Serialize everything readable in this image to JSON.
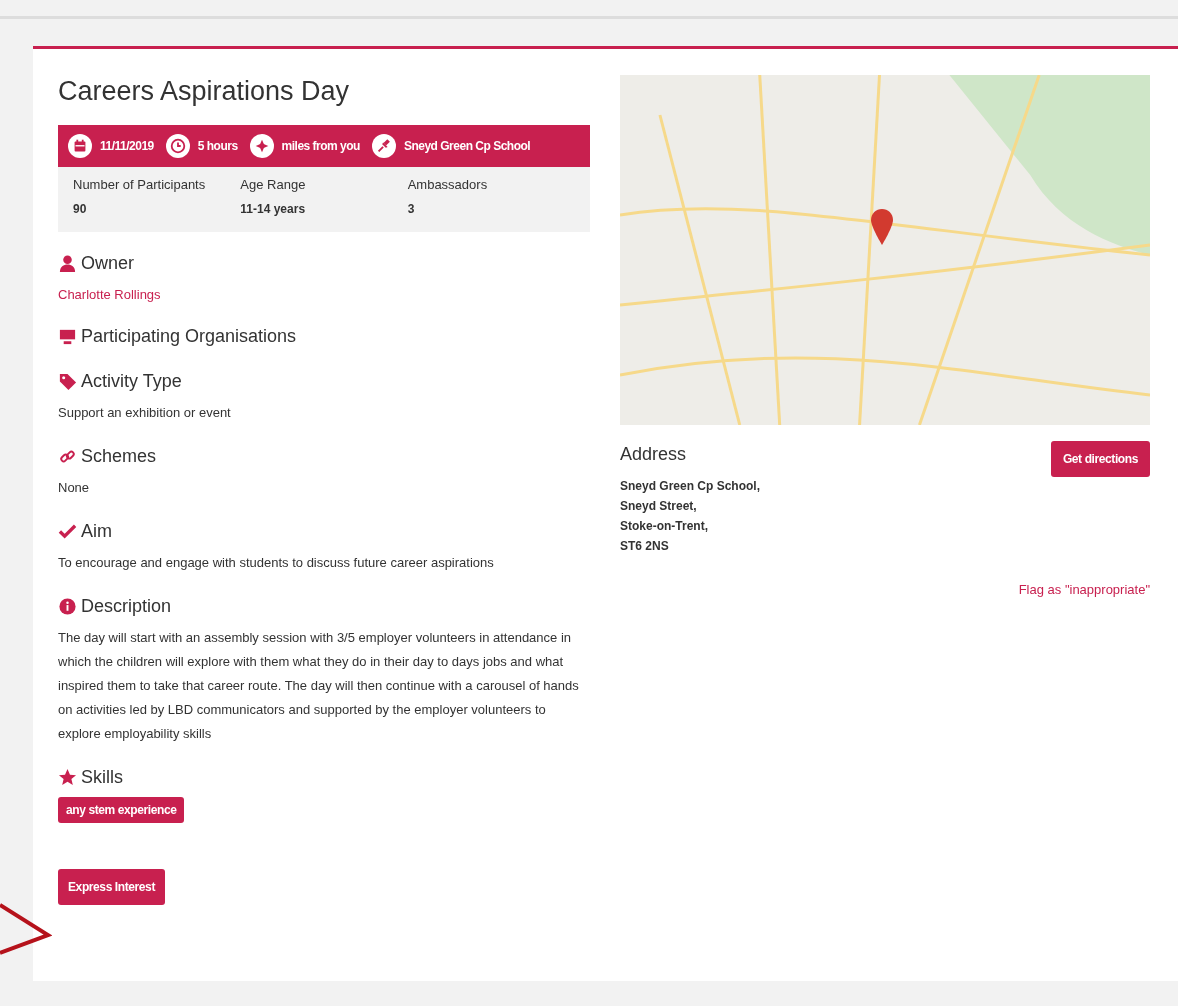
{
  "title": "Careers Aspirations Day",
  "banner": [
    {
      "kind": "date",
      "text": "11/11/2019"
    },
    {
      "kind": "duration",
      "text": "5 hours"
    },
    {
      "kind": "distance",
      "text": "miles from you"
    },
    {
      "kind": "place",
      "text": "Sneyd Green Cp School"
    }
  ],
  "facts": [
    {
      "label": "Number of Participants",
      "value": "90"
    },
    {
      "label": "Age Range",
      "value": "11-14 years"
    },
    {
      "label": "Ambassadors",
      "value": "3"
    }
  ],
  "sections": [
    {
      "kind": "owner",
      "heading": "Owner",
      "link": "Charlotte Rollings"
    },
    {
      "kind": "organisations",
      "heading": "Participating Organisations"
    },
    {
      "kind": "activity",
      "heading": "Activity Type",
      "text": "Support an exhibition or event"
    },
    {
      "kind": "schemes",
      "heading": "Schemes",
      "text": "None"
    },
    {
      "kind": "aim",
      "heading": "Aim",
      "text": "To encourage and engage with students to discuss future career aspirations"
    },
    {
      "kind": "description",
      "heading": "Description",
      "text": "The day will start with an assembly session with 3/5 employer volunteers in attendance in which the children will explore with them what they do in their day to days jobs and what inspired them to take that career route. The day will then continue with a carousel of hands on activities led by LBD communicators and supported by the employer volunteers to explore employability skills"
    },
    {
      "kind": "skills",
      "heading": "Skills",
      "tags": [
        "any stem experience"
      ]
    }
  ],
  "primary_button": "Express Interest",
  "address": {
    "heading": "Address",
    "lines": [
      "Sneyd Green Cp School,",
      "Sneyd Street,",
      "Stoke-on-Trent,",
      "ST6 2NS"
    ],
    "button": "Get directions"
  },
  "flag_link": "Flag as \"inappropriate\""
}
